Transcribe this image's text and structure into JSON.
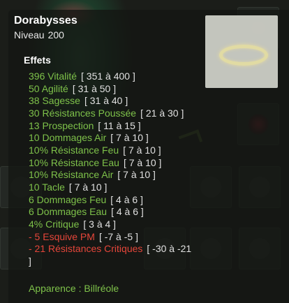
{
  "item": {
    "name": "Dorabysses",
    "level_label": "Niveau",
    "level": "200",
    "image_icon": "halo-icon"
  },
  "effects": {
    "title": "Effets",
    "list": [
      {
        "text": "396 Vitalité",
        "range": "[ 351 à 400 ]",
        "kind": "pos"
      },
      {
        "text": "50 Agilité",
        "range": "[ 31 à 50 ]",
        "kind": "pos"
      },
      {
        "text": "38 Sagesse",
        "range": "[ 31 à 40 ]",
        "kind": "pos"
      },
      {
        "text": "30 Résistances Poussée",
        "range": "[ 21 à 30 ]",
        "kind": "pos"
      },
      {
        "text": "13 Prospection",
        "range": "[ 11 à 15 ]",
        "kind": "pos"
      },
      {
        "text": "10 Dommages Air",
        "range": "[ 7 à 10 ]",
        "kind": "pos"
      },
      {
        "text": "10% Résistance Feu",
        "range": "[ 7 à 10 ]",
        "kind": "pos"
      },
      {
        "text": "10% Résistance Eau",
        "range": "[ 7 à 10 ]",
        "kind": "pos"
      },
      {
        "text": "10% Résistance Air",
        "range": "[ 7 à 10 ]",
        "kind": "pos"
      },
      {
        "text": "10 Tacle",
        "range": "[ 7 à 10 ]",
        "kind": "pos"
      },
      {
        "text": "6 Dommages Feu",
        "range": "[ 4 à 6 ]",
        "kind": "pos"
      },
      {
        "text": "6 Dommages Eau",
        "range": "[ 4 à 6 ]",
        "kind": "pos"
      },
      {
        "text": "4% Critique",
        "range": "[ 3 à 4 ]",
        "kind": "pos"
      },
      {
        "text": "- 5 Esquive PM",
        "range": "[ -7 à -5 ]",
        "kind": "neg"
      },
      {
        "text": "- 21 Résistances Critiques",
        "range": "[ -30 à -21 ]",
        "kind": "neg"
      }
    ]
  },
  "appearance": "Apparence : Billréole",
  "colors": {
    "positive": "#7ec24a",
    "negative": "#e5463a",
    "range": "#e0e0e0",
    "title": "#ffffff"
  }
}
